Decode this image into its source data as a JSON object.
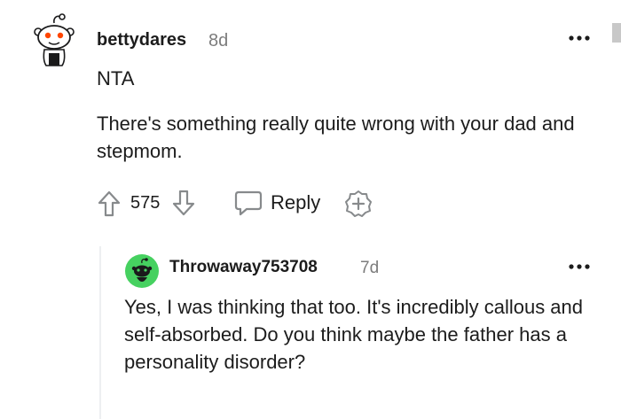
{
  "comment": {
    "username": "bettydares",
    "age": "8d",
    "body_line1": "NTA",
    "body_line2": "There's something really quite wrong with your dad and stepmom.",
    "score": "575",
    "reply_label": "Reply",
    "avatar_icon": "snoo-avatar-icon",
    "more_icon": "more-options-icon"
  },
  "reply": {
    "username": "Throwaway753708",
    "age": "7d",
    "body": "Yes, I was thinking that too. It's incredibly callous and self-absorbed. Do you think maybe the father has a personality disorder?",
    "avatar_icon": "green-snoo-avatar-icon",
    "more_icon": "more-options-icon"
  },
  "colors": {
    "text": "#1c1c1c",
    "meta": "#7c7c7c",
    "icon": "#878a8c",
    "thread_line": "#edeff1",
    "avatar_green": "#46d160"
  }
}
